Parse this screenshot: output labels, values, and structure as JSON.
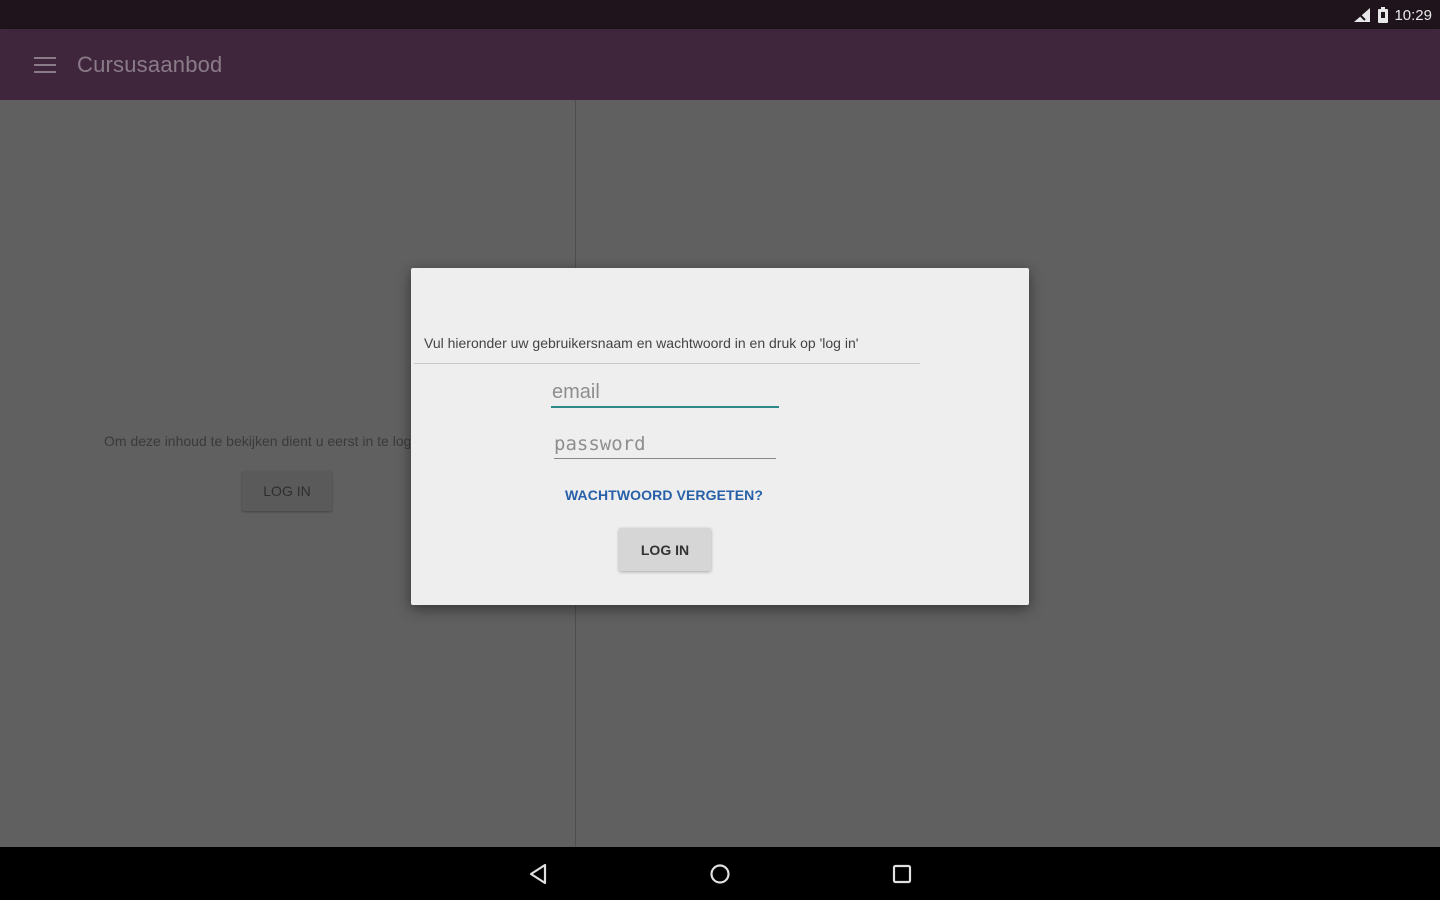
{
  "status_bar": {
    "time": "10:29",
    "icons": [
      "signal-icon",
      "battery-icon"
    ]
  },
  "app_bar": {
    "title": "Cursusaanbod",
    "menu_icon": "menu-icon"
  },
  "left_pane": {
    "message": "Om deze inhoud te bekijken dient u eerst in te loggen",
    "login_button": "LOG IN"
  },
  "dialog": {
    "message": "Vul hieronder uw gebruikersnaam en wachtwoord in en druk op 'log in'",
    "email": {
      "value": "",
      "placeholder": "email"
    },
    "password": {
      "value": "",
      "placeholder": "password"
    },
    "forgot_link": "WACHTWOORD VERGETEN?",
    "login_button": "LOG IN"
  },
  "nav_bar": {
    "buttons": [
      "back-icon",
      "home-icon",
      "recents-icon"
    ]
  },
  "colors": {
    "app_bar": "#40263d",
    "status_bar": "#1f131c",
    "accent": "#2e8a86",
    "link": "#2760a8"
  }
}
